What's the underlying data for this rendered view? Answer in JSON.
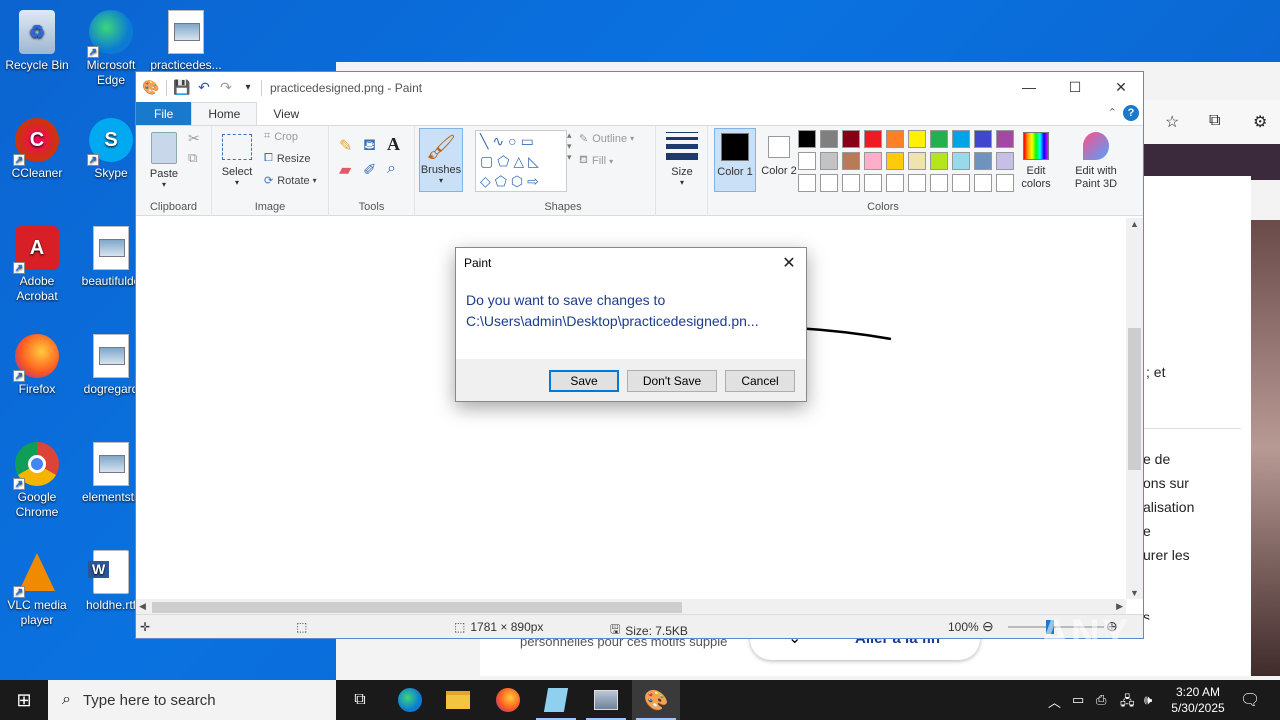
{
  "desktop": {
    "icons": [
      {
        "label": "Recycle Bin",
        "icon": "recycle-bin-icon"
      },
      {
        "label": "Microsoft Edge",
        "icon": "edge-icon"
      },
      {
        "label": "practicedes...",
        "icon": "image-file-icon"
      },
      {
        "label": "CCleaner",
        "icon": "ccleaner-icon"
      },
      {
        "label": "Skype",
        "icon": "skype-icon"
      },
      {
        "label": "Adobe Acrobat",
        "icon": "acrobat-icon"
      },
      {
        "label": "beautifulde",
        "icon": "image-file-icon"
      },
      {
        "label": "Firefox",
        "icon": "firefox-icon"
      },
      {
        "label": "dogregard",
        "icon": "image-file-icon"
      },
      {
        "label": "Google Chrome",
        "icon": "chrome-icon"
      },
      {
        "label": "elementstit",
        "icon": "image-file-icon"
      },
      {
        "label": "VLC media player",
        "icon": "vlc-icon"
      },
      {
        "label": "holdhe.rtf",
        "icon": "word-doc-icon"
      }
    ]
  },
  "browser_bg": {
    "texts": [
      "; et",
      "e de",
      "ons sur",
      "alisation",
      "e",
      "urer les",
      "s",
      "personnelles pour ces motifs supplé",
      "Aller à la fin"
    ]
  },
  "paint": {
    "title": "practicedesigned.png - Paint",
    "tabs": [
      "File",
      "Home",
      "View"
    ],
    "clipboard": {
      "paste": "Paste",
      "label": "Clipboard"
    },
    "image": {
      "select": "Select",
      "crop": "Crop",
      "resize": "Resize",
      "rotate": "Rotate",
      "label": "Image"
    },
    "tools": {
      "label": "Tools"
    },
    "brushes": {
      "label": "Brushes"
    },
    "shapes": {
      "outline": "Outline",
      "fill": "Fill",
      "label": "Shapes"
    },
    "size": {
      "label": "Size"
    },
    "colors": {
      "color1": "Color 1",
      "color2": "Color 2",
      "edit": "Edit colors",
      "label": "Colors",
      "color1_value": "#000000",
      "color2_value": "#ffffff",
      "row1": [
        "#000000",
        "#7f7f7f",
        "#880015",
        "#ed1c24",
        "#ff7f27",
        "#fff200",
        "#22b14c",
        "#00a2e8",
        "#3f48cc",
        "#a349a4"
      ],
      "row2": [
        "#ffffff",
        "#c3c3c3",
        "#b97a57",
        "#ffaec9",
        "#ffc90e",
        "#efe4b0",
        "#b5e61d",
        "#99d9ea",
        "#7092be",
        "#c8bfe7"
      ]
    },
    "paint3d": "Edit with Paint 3D",
    "status": {
      "dimensions": "1781 × 890px",
      "size": "Size: 7.5KB",
      "zoom": "100%"
    }
  },
  "dialog": {
    "title": "Paint",
    "message_line1": "Do you want to save changes to",
    "message_line2": "C:\\Users\\admin\\Desktop\\practicedesigned.pn...",
    "save": "Save",
    "dont_save": "Don't Save",
    "cancel": "Cancel"
  },
  "taskbar": {
    "search_placeholder": "Type here to search",
    "time": "3:20 AM",
    "date": "5/30/2025"
  },
  "watermark": "ANY RUN"
}
